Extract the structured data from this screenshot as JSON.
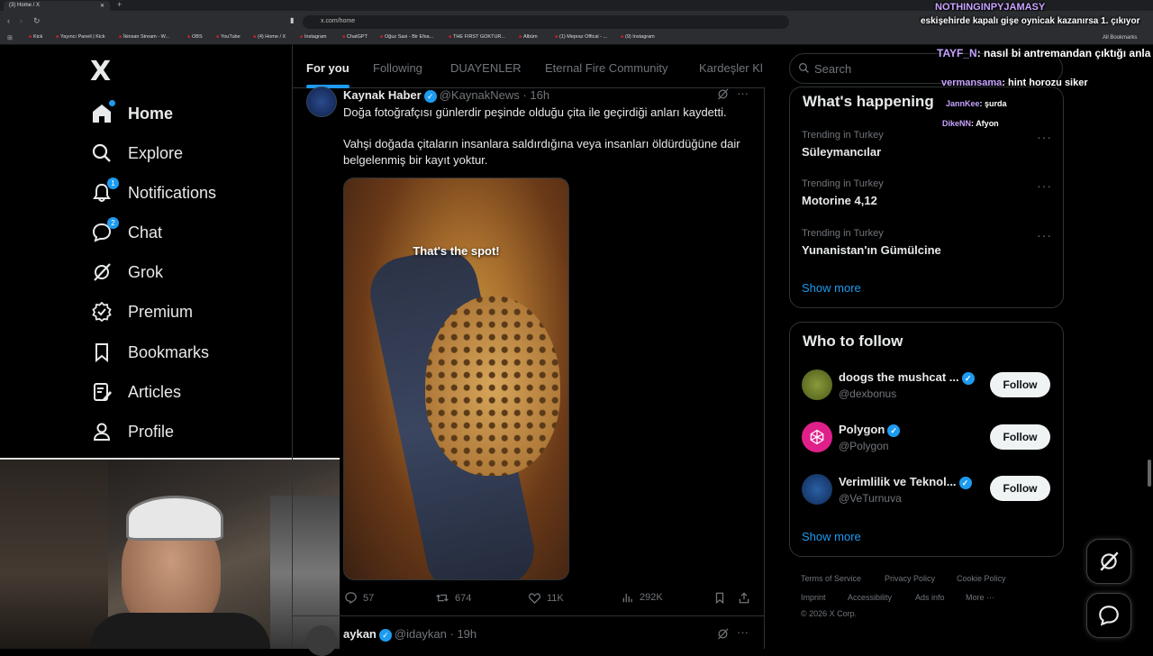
{
  "browser": {
    "tab_title": "(3) Home / X",
    "url": "x.com/home",
    "all_bookmarks": "All Bookmarks",
    "bookmarks": [
      "Kick",
      "Yayıncı Paneli | Kick",
      "İkinsan Stream - W...",
      "OBS",
      "YouTube",
      "(4) Home / X",
      "Instagram",
      "ChatGPT",
      "Oğuz Sasi - Bir Efsa...",
      "THE FIRST GOKTUR...",
      "Albüm",
      "(1) Mepraz Offical - ...",
      "(9) Instagram"
    ]
  },
  "sidebar": {
    "logo": "X",
    "items": [
      {
        "label": "Home",
        "icon": "home-icon",
        "badge": ""
      },
      {
        "label": "Explore",
        "icon": "search-icon",
        "badge": ""
      },
      {
        "label": "Notifications",
        "icon": "bell-icon",
        "badge": "1"
      },
      {
        "label": "Chat",
        "icon": "chat-icon",
        "badge": "2"
      },
      {
        "label": "Grok",
        "icon": "grok-icon",
        "badge": ""
      },
      {
        "label": "Premium",
        "icon": "premium-icon",
        "badge": ""
      },
      {
        "label": "Bookmarks",
        "icon": "bookmark-icon",
        "badge": ""
      },
      {
        "label": "Articles",
        "icon": "articles-icon",
        "badge": ""
      },
      {
        "label": "Profile",
        "icon": "profile-icon",
        "badge": ""
      }
    ]
  },
  "timeline": {
    "tabs": [
      "For you",
      "Following",
      "DUAYENLER",
      "Eternal Fire Community",
      "Kardeşler Kl"
    ],
    "tweet": {
      "name": "Kaynak Haber",
      "handle": "@KaynakNews",
      "time": "· 16h",
      "text1": "Doğa fotoğrafçısı günlerdir peşinde olduğu çita ile geçirdiği anları kaydetti.",
      "text2": "Vahşi doğada çitaların insanlara saldırdığına veya insanları öldürdüğüne dair belgelenmiş bir kayıt yoktur.",
      "media_caption": "That's the spot!",
      "replies": "57",
      "reposts": "674",
      "likes": "11K",
      "views": "292K"
    },
    "next_tweet": {
      "name": "aykan",
      "handle": "@idaykan",
      "time": "· 19h"
    }
  },
  "right": {
    "search_placeholder": "Search",
    "happening_title": "What's happening",
    "trends": [
      {
        "meta": "Trending in Turkey",
        "name": "Süleymancılar"
      },
      {
        "meta": "Trending in Turkey",
        "name": "Motorine 4,12"
      },
      {
        "meta": "Trending in Turkey",
        "name": "Yunanistan'ın Gümülcine"
      }
    ],
    "show_more": "Show more",
    "follow_title": "Who to follow",
    "follows": [
      {
        "name": "doogs the mushcat ...",
        "handle": "@dexbonus",
        "button": "Follow",
        "avatar_color": "#6b7a2a"
      },
      {
        "name": "Polygon",
        "handle": "@Polygon",
        "button": "Follow",
        "avatar_color": "#e0208a"
      },
      {
        "name": "Verimlilik ve Teknol...",
        "handle": "@VeTurnuva",
        "button": "Follow",
        "avatar_color": "#1f3f73"
      }
    ],
    "footer": [
      "Terms of Service",
      "Privacy Policy",
      "Cookie Policy",
      "Imprint",
      "Accessibility",
      "Ads info",
      "More ···",
      "© 2026 X Corp."
    ]
  },
  "chat_overlay": [
    {
      "user": "NOTHINGINPYJAMASY",
      "msg": "eskişehirde kapalı gişe oynicak kazanırsa 1. çıkıyor"
    },
    {
      "user": "TAYF_N",
      "msg": "nasıl bi antremandan çıktığı anla"
    },
    {
      "user": "vermansama",
      "msg": "hint horozu siker"
    },
    {
      "user": "JannKee",
      "msg": "şurda"
    },
    {
      "user": "DikeNN",
      "msg": "Afyon"
    }
  ],
  "colors": {
    "accent": "#1d9bf0",
    "border": "#2f3336",
    "muted": "#71767b"
  }
}
